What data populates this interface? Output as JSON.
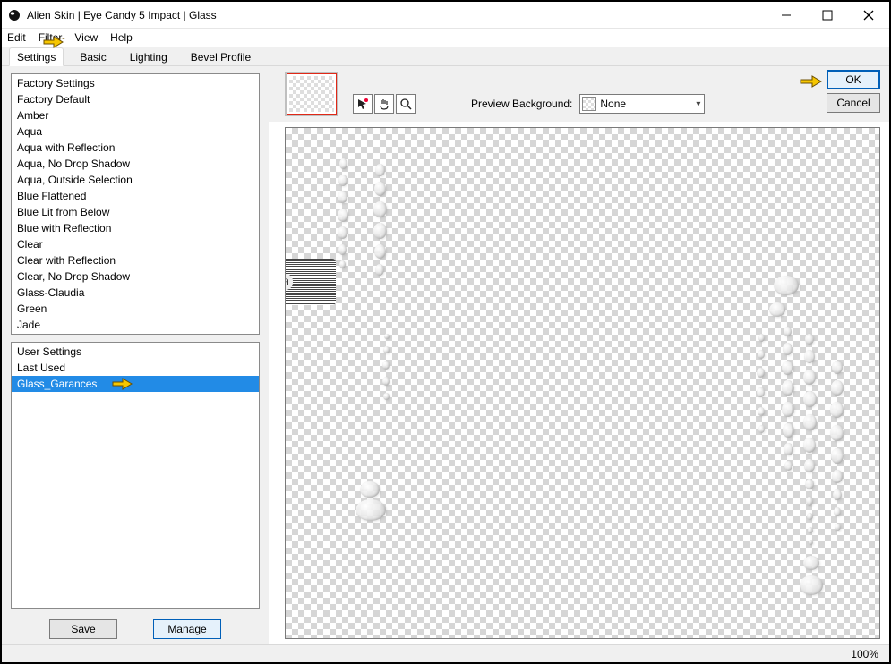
{
  "window": {
    "title": "Alien Skin | Eye Candy 5 Impact | Glass"
  },
  "menubar": {
    "edit": "Edit",
    "filter": "Filter",
    "view": "View",
    "help": "Help"
  },
  "tabs": {
    "settings": "Settings",
    "basic": "Basic",
    "lighting": "Lighting",
    "bevel": "Bevel Profile"
  },
  "factory_header": "Factory Settings",
  "factory_items": [
    "Factory Default",
    "Amber",
    "Aqua",
    "Aqua with Reflection",
    "Aqua, No Drop Shadow",
    "Aqua, Outside Selection",
    "Blue Flattened",
    "Blue Lit from Below",
    "Blue with Reflection",
    "Clear",
    "Clear with Reflection",
    "Clear, No Drop Shadow",
    "Glass-Claudia",
    "Green",
    "Jade"
  ],
  "user_header": "User Settings",
  "user_items": [
    {
      "label": "Last Used",
      "selected": false
    },
    {
      "label": "Glass_Garances",
      "selected": true
    }
  ],
  "buttons": {
    "save": "Save",
    "manage": "Manage"
  },
  "preview_bg_label": "Preview Background:",
  "preview_bg_value": "None",
  "ok": "OK",
  "cancel": "Cancel",
  "watermark": "claudia",
  "zoom": "100%"
}
